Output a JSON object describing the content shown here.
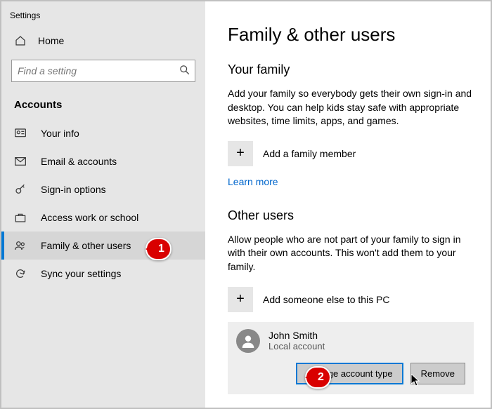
{
  "app": {
    "title": "Settings"
  },
  "sidebar": {
    "home": "Home",
    "search_placeholder": "Find a setting",
    "category": "Accounts",
    "items": [
      {
        "label": "Your info"
      },
      {
        "label": "Email & accounts"
      },
      {
        "label": "Sign-in options"
      },
      {
        "label": "Access work or school"
      },
      {
        "label": "Family & other users"
      },
      {
        "label": "Sync your settings"
      }
    ]
  },
  "page": {
    "title": "Family & other users",
    "family": {
      "heading": "Your family",
      "desc": "Add your family so everybody gets their own sign-in and desktop. You can help kids stay safe with appropriate websites, time limits, apps, and games.",
      "add_label": "Add a family member",
      "learn_more": "Learn more"
    },
    "other": {
      "heading": "Other users",
      "desc": "Allow people who are not part of your family to sign in with their own accounts. This won't add them to your family.",
      "add_label": "Add someone else to this PC",
      "user": {
        "name": "John Smith",
        "subtitle": "Local account"
      },
      "change_btn": "Change account type",
      "remove_btn": "Remove"
    }
  },
  "annotations": {
    "m1": "1",
    "m2": "2"
  }
}
